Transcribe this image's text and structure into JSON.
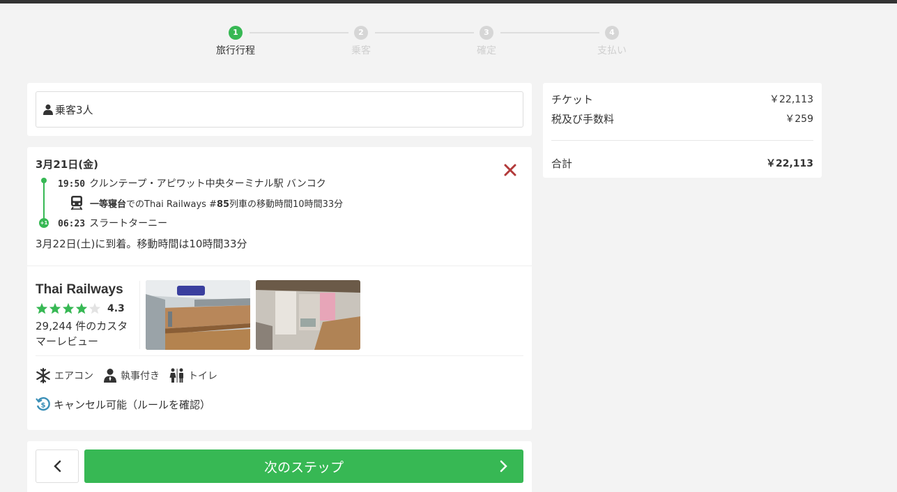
{
  "stepper": {
    "steps": [
      {
        "num": "1",
        "label": "旅行行程"
      },
      {
        "num": "2",
        "label": "乗客"
      },
      {
        "num": "3",
        "label": "確定"
      },
      {
        "num": "4",
        "label": "支払い"
      }
    ]
  },
  "passengers": {
    "label": "乗客3人"
  },
  "trip": {
    "date": "3月21日(金)",
    "depart_time": "19:50",
    "depart_station": "クルンテープ・アピワット中央ターミナル駅 バンコク",
    "class_name": "一等寝台",
    "train_mid1": "でのThai Railways #",
    "train_number": "85",
    "train_mid2": "列車の移動時間10時間33分",
    "arrive_time": "06:23",
    "arrive_station": "スラートターニー",
    "day_offset": "+1",
    "arrival_summary": "3月22日(土)に到着。移動時間は10時間33分"
  },
  "operator": {
    "name": "Thai Railways",
    "rating": "4.3",
    "stars_filled": 4,
    "reviews": "29,244 件のカスタマーレビュー"
  },
  "amenities": {
    "ac": "エアコン",
    "attendant": "執事付き",
    "toilet": "トイレ"
  },
  "cancel": {
    "label": "キャンセル可能（ルールを確認）"
  },
  "nav": {
    "next_label": "次のステップ"
  },
  "summary": {
    "ticket_label": "チケット",
    "ticket_amount": "￥22,113",
    "tax_label": "税及び手数料",
    "tax_amount": "￥259",
    "total_label": "合計",
    "total_amount": "￥22,113"
  },
  "colors": {
    "accent": "#37b854",
    "remove": "#b23a3a",
    "cancel_icon": "#3a8fb7"
  }
}
